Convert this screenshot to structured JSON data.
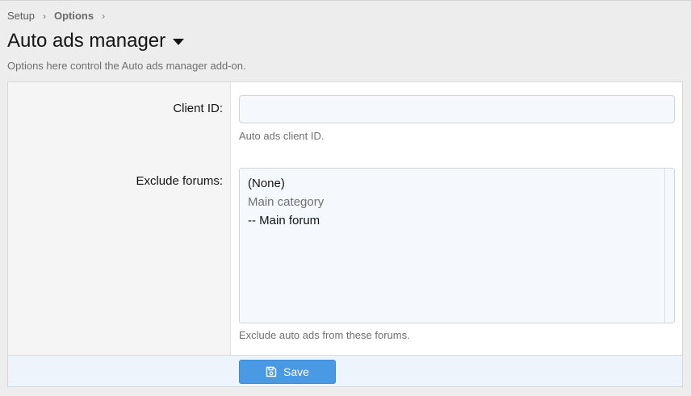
{
  "breadcrumb": {
    "items": [
      "Setup",
      "Options"
    ]
  },
  "page": {
    "title": "Auto ads manager",
    "description": "Options here control the Auto ads manager add-on."
  },
  "form": {
    "client_id": {
      "label": "Client ID:",
      "value": "",
      "hint": "Auto ads client ID."
    },
    "exclude_forums": {
      "label": "Exclude forums:",
      "options": [
        "(None)",
        "Main category",
        "-- Main forum"
      ],
      "hint": "Exclude auto ads from these forums."
    }
  },
  "actions": {
    "save_label": "Save"
  },
  "icons": {
    "breadcrumb_separator": "chevron-right-icon",
    "title_menu": "caret-down-icon",
    "save": "floppy-disk-icon"
  },
  "colors": {
    "primary_button": "#4a99e4",
    "input_background": "#f5f9fd",
    "footer_background": "#eef4fb"
  }
}
